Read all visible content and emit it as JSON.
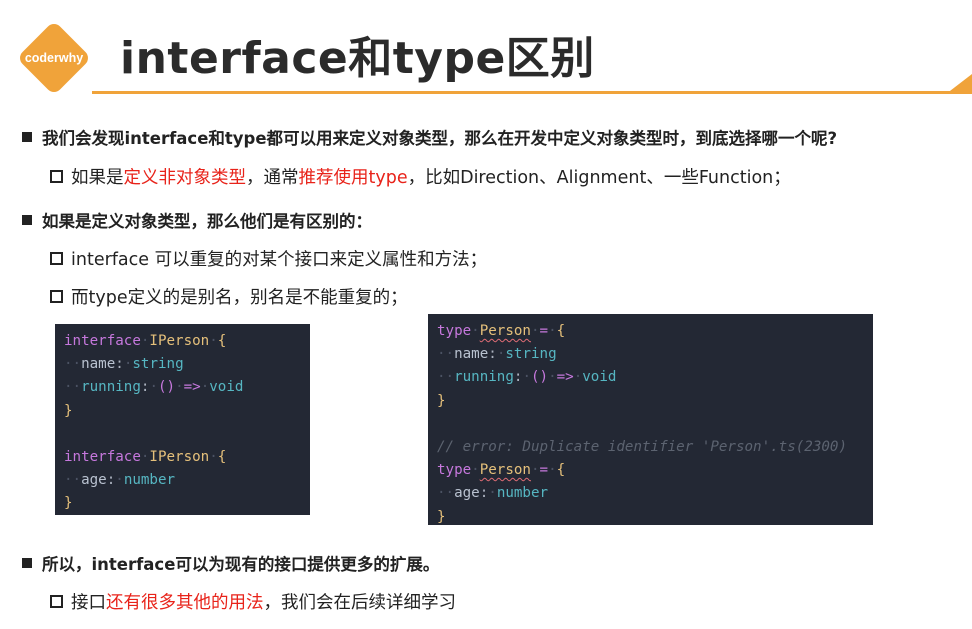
{
  "logo": {
    "text": "coderwhy",
    "color": "#f0a33a"
  },
  "title": "interface和type区别",
  "accent_color": "#f0a33a",
  "highlight_color": "#e8231a",
  "bullets": {
    "b1": "我们会发现interface和type都可以用来定义对象类型，那么在开发中定义对象类型时，到底选择哪一个呢?",
    "s1": {
      "pre": "如果是",
      "red1": "定义非对象类型",
      "mid": "，通常",
      "red2": "推荐使用type",
      "post": "，比如Direction、Alignment、一些Function；"
    },
    "b2": "如果是定义对象类型，那么他们是有区别的：",
    "s2": "interface 可以重复的对某个接口来定义属性和方法；",
    "s3": "而type定义的是别名，别名是不能重复的；",
    "b3": "所以，interface可以为现有的接口提供更多的扩展。",
    "s4": {
      "pre": "接口",
      "red": "还有很多其他的用法",
      "post": "，我们会在后续详细学习"
    }
  },
  "code_left": {
    "kw": "interface",
    "name": "IPerson",
    "open": "{",
    "close": "}",
    "prop_name": "name",
    "type_string": "string",
    "prop_running": "running",
    "fn_parens": "()",
    "arrow": "=>",
    "type_void": "void",
    "prop_age": "age",
    "type_number": "number",
    "colon": ":"
  },
  "code_right": {
    "kw": "type",
    "name": "Person",
    "eq": "=",
    "comment": "// error: Duplicate identifier 'Person'.ts(2300)"
  }
}
